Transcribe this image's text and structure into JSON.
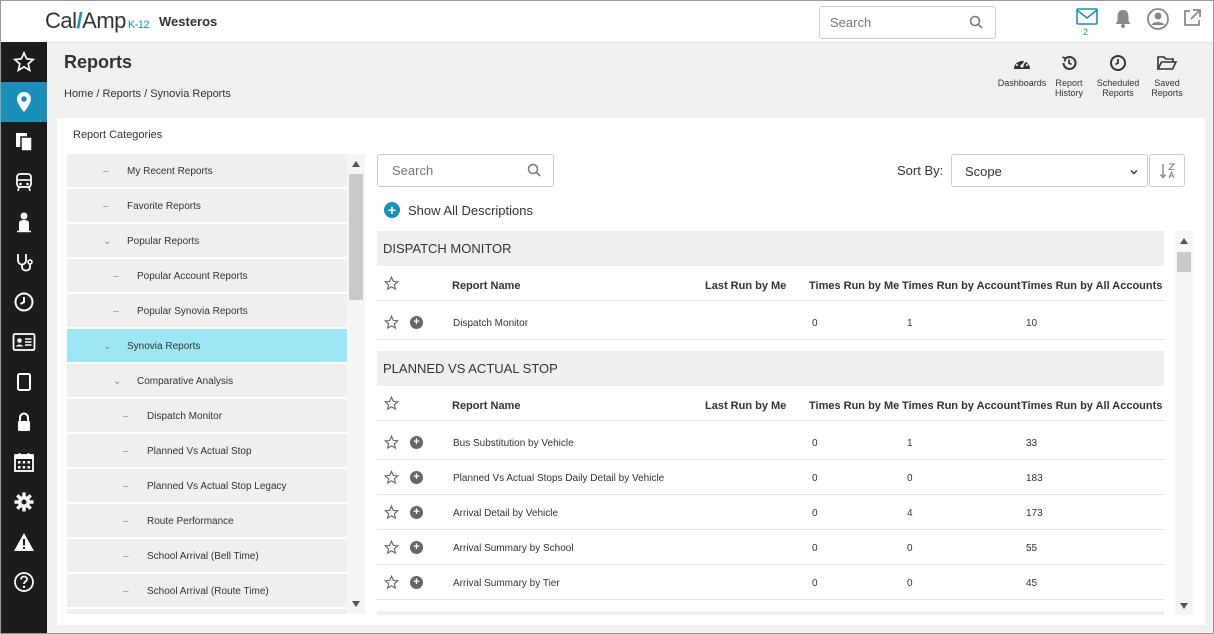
{
  "app": {
    "logo_main": "Cal",
    "logo_slash": "/",
    "logo_rest": "Amp",
    "logo_sub": "K-12",
    "account_name": "Westeros"
  },
  "top_search": {
    "placeholder": "Search"
  },
  "top_icons": {
    "messages_count": "2"
  },
  "page": {
    "title": "Reports",
    "breadcrumb": "Home / Reports / Synovia Reports"
  },
  "header_actions": [
    {
      "line1": "Dashboards",
      "line2": ""
    },
    {
      "line1": "Report",
      "line2": "History"
    },
    {
      "line1": "Scheduled",
      "line2": "Reports"
    },
    {
      "line1": "Saved",
      "line2": "Reports"
    }
  ],
  "categories": {
    "title": "Report Categories",
    "items": [
      {
        "label": "My Recent Reports",
        "marker": "–",
        "selected": false
      },
      {
        "label": "Favorite Reports",
        "marker": "–",
        "selected": false
      },
      {
        "label": "Popular Reports",
        "marker": "⌄",
        "selected": false
      },
      {
        "label": "Popular Account Reports",
        "marker": "–",
        "selected": false
      },
      {
        "label": "Popular Synovia Reports",
        "marker": "–",
        "selected": false
      },
      {
        "label": "Synovia Reports",
        "marker": "⌄",
        "selected": true
      },
      {
        "label": "Comparative Analysis",
        "marker": "⌄",
        "selected": false
      },
      {
        "label": "Dispatch Monitor",
        "marker": "–",
        "selected": false
      },
      {
        "label": "Planned Vs Actual Stop",
        "marker": "–",
        "selected": false
      },
      {
        "label": "Planned Vs Actual Stop Legacy",
        "marker": "–",
        "selected": false
      },
      {
        "label": "Route Performance",
        "marker": "–",
        "selected": false
      },
      {
        "label": "School Arrival (Bell Time)",
        "marker": "–",
        "selected": false
      },
      {
        "label": "School Arrival (Route Time)",
        "marker": "–",
        "selected": false
      }
    ]
  },
  "list_search": {
    "placeholder": "Search"
  },
  "sort": {
    "label": "Sort By:",
    "value": "Scope"
  },
  "show_descriptions": "Show All Descriptions",
  "columns": {
    "report_name": "Report Name",
    "last_run": "Last Run by Me",
    "times_me": "Times Run by Me",
    "times_account": "Times Run by Account",
    "times_all": "Times Run by All Accounts"
  },
  "sections": [
    {
      "title": "DISPATCH MONITOR",
      "rows": [
        {
          "name": "Dispatch Monitor",
          "times_me": "0",
          "times_account": "1",
          "times_all": "10"
        }
      ]
    },
    {
      "title": "PLANNED VS ACTUAL STOP",
      "rows": [
        {
          "name": "Bus Substitution by Vehicle",
          "times_me": "0",
          "times_account": "1",
          "times_all": "33"
        },
        {
          "name": "Planned Vs Actual Stops Daily Detail by Vehicle",
          "times_me": "0",
          "times_account": "0",
          "times_all": "183"
        },
        {
          "name": "Arrival Detail by Vehicle",
          "times_me": "0",
          "times_account": "4",
          "times_all": "173"
        },
        {
          "name": "Arrival Summary by School",
          "times_me": "0",
          "times_account": "0",
          "times_all": "55"
        },
        {
          "name": "Arrival Summary by Tier",
          "times_me": "0",
          "times_account": "0",
          "times_all": "45"
        }
      ]
    }
  ],
  "colors": {
    "accent": "#1a8fb8",
    "selected_row": "#9de6f4",
    "nav_bg": "#1c1c1c"
  }
}
